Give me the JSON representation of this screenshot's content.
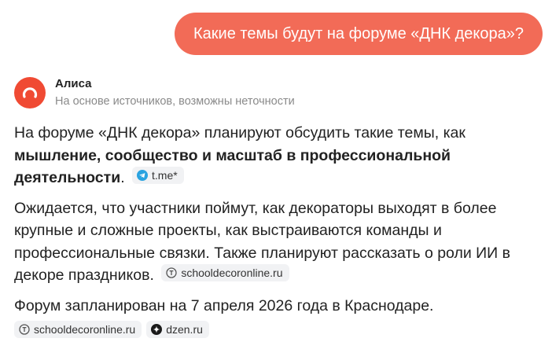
{
  "user_message": "Какие темы будут на форуме «ДНК декора»?",
  "assistant": {
    "name": "Алиса",
    "subtitle": "На основе источников, возможны неточности"
  },
  "answer": {
    "p1_text": "На форуме «ДНК декора» планируют обсудить такие темы, как ",
    "p1_bold": "мышление, сообщество и масштаб в профессиональной деятельности",
    "p1_end": ".",
    "p1_source": "t.me*",
    "p2_text": "Ожидается, что участники поймут, как декораторы выходят в более крупные и сложные проекты, как выстраиваются команды и профессиональные связки. Также планируют рассказать о роли ИИ в декоре праздников.",
    "p2_source": "schooldecoronline.ru",
    "p3_text": "Форум запланирован на 7 апреля 2026 года в Краснодаре.",
    "p3_sources": [
      "schooldecoronline.ru",
      "dzen.ru"
    ]
  },
  "icons": {
    "avatar": "alice-logo-icon",
    "telegram": "telegram-icon",
    "site": "site-globe-icon",
    "dzen": "dzen-icon"
  },
  "colors": {
    "accent": "#f26b57",
    "avatar": "#f04a33",
    "telegram": "#2aa3e0"
  }
}
